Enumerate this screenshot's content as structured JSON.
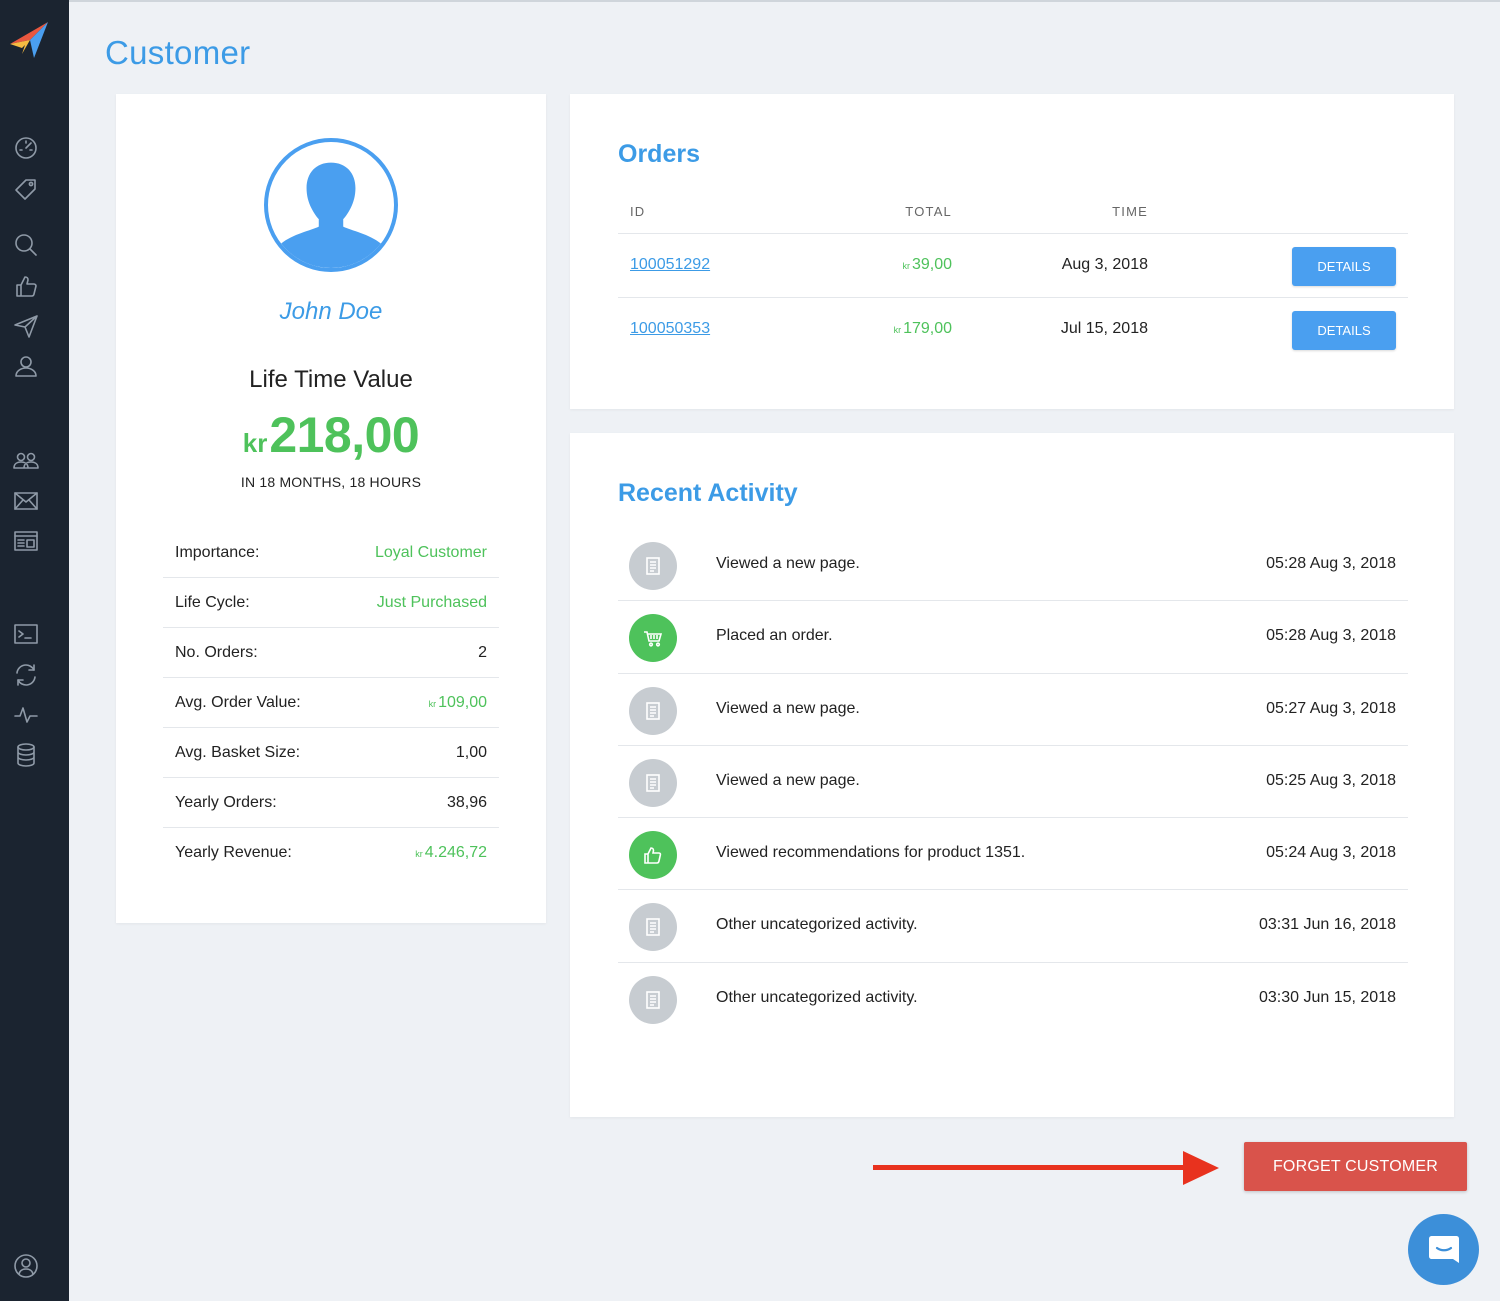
{
  "page": {
    "title": "Customer"
  },
  "sidebar": {
    "items": [
      {
        "name": "dashboard-icon"
      },
      {
        "name": "tag-icon"
      },
      {
        "name": "search-icon"
      },
      {
        "name": "thumbs-up-icon"
      },
      {
        "name": "paper-plane-icon"
      },
      {
        "name": "user-icon"
      },
      {
        "name": "users-group-icon"
      },
      {
        "name": "envelope-icon"
      },
      {
        "name": "layout-icon"
      },
      {
        "name": "terminal-icon"
      },
      {
        "name": "sync-icon"
      },
      {
        "name": "pulse-icon"
      },
      {
        "name": "database-icon"
      },
      {
        "name": "account-icon"
      }
    ]
  },
  "profile": {
    "name": "John Doe",
    "ltv_label": "Life Time Value",
    "ltv_currency": "kr",
    "ltv_value": "218,00",
    "ltv_period": "IN 18 MONTHS, 18 HOURS",
    "stats": [
      {
        "label": "Importance:",
        "value": "Loyal Customer",
        "color": "green",
        "currency": ""
      },
      {
        "label": "Life Cycle:",
        "value": "Just Purchased",
        "color": "green",
        "currency": ""
      },
      {
        "label": "No. Orders:",
        "value": "2",
        "color": "dark",
        "currency": ""
      },
      {
        "label": "Avg. Order Value:",
        "value": "109,00",
        "color": "green",
        "currency": "kr"
      },
      {
        "label": "Avg. Basket Size:",
        "value": "1,00",
        "color": "dark",
        "currency": ""
      },
      {
        "label": "Yearly Orders:",
        "value": "38,96",
        "color": "dark",
        "currency": ""
      },
      {
        "label": "Yearly Revenue:",
        "value": "4.246,72",
        "color": "green",
        "currency": "kr"
      }
    ]
  },
  "orders": {
    "title": "Orders",
    "columns": {
      "id": "ID",
      "total": "TOTAL",
      "time": "TIME"
    },
    "rows": [
      {
        "id": "100051292",
        "currency": "kr",
        "total": "39,00",
        "time": "Aug 3, 2018",
        "action": "DETAILS"
      },
      {
        "id": "100050353",
        "currency": "kr",
        "total": "179,00",
        "time": "Jul 15, 2018",
        "action": "DETAILS"
      }
    ]
  },
  "activity": {
    "title": "Recent Activity",
    "items": [
      {
        "icon": "page-icon",
        "text": "Viewed a new page.",
        "time": "05:28 Aug 3, 2018"
      },
      {
        "icon": "cart-icon",
        "text": "Placed an order.",
        "time": "05:28 Aug 3, 2018"
      },
      {
        "icon": "page-icon",
        "text": "Viewed a new page.",
        "time": "05:27 Aug 3, 2018"
      },
      {
        "icon": "page-icon",
        "text": "Viewed a new page.",
        "time": "05:25 Aug 3, 2018"
      },
      {
        "icon": "thumbs-up-icon",
        "text": "Viewed recommendations for product 1351.",
        "time": "05:24 Aug 3, 2018"
      },
      {
        "icon": "page-icon",
        "text": "Other uncategorized activity.",
        "time": "03:31 Jun 16, 2018"
      },
      {
        "icon": "page-icon",
        "text": "Other uncategorized activity.",
        "time": "03:30 Jun 15, 2018"
      }
    ]
  },
  "actions": {
    "forget_label": "FORGET CUSTOMER"
  },
  "colors": {
    "accent": "#3c9be6",
    "green": "#4ec25b",
    "danger": "#d9534b",
    "sidebar": "#1b2430",
    "arrow": "#e8321e"
  }
}
